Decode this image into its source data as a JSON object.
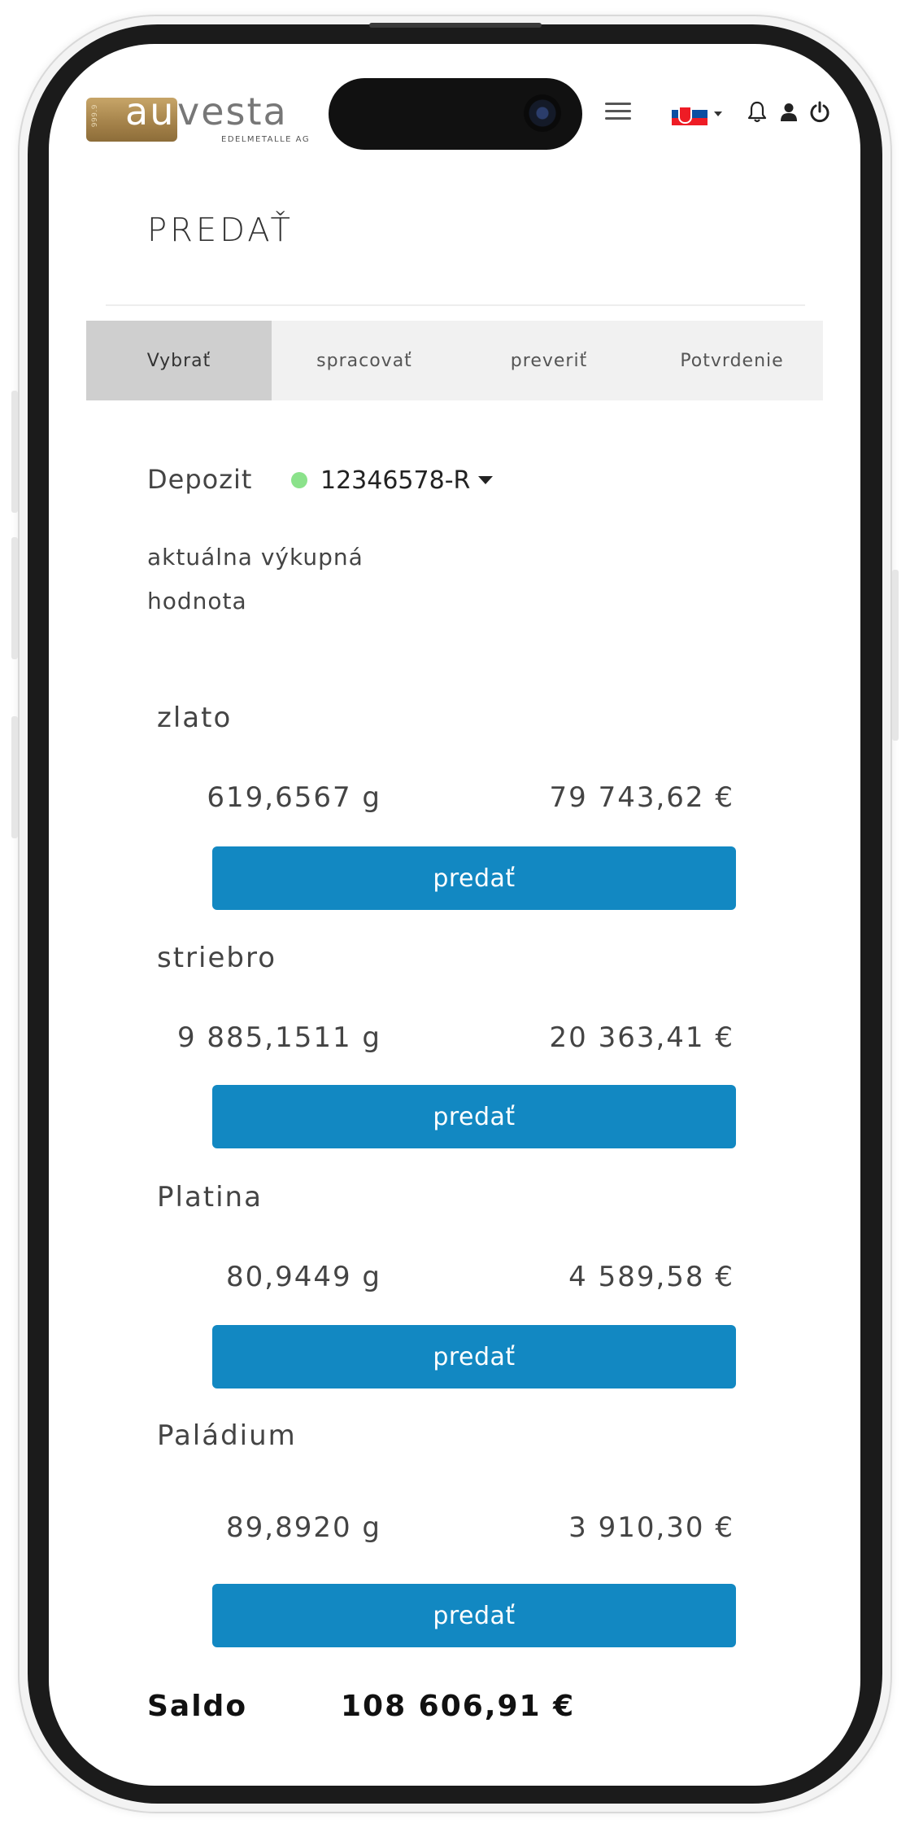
{
  "header": {
    "logo_au": "au",
    "logo_vesta": "vesta",
    "logo_sub": "EDELMETALLE AG",
    "logo_stamp": "999.9",
    "language": "Slovenčina"
  },
  "page": {
    "title": "PREDAŤ"
  },
  "tabs": [
    {
      "label": "Vybrať",
      "active": true
    },
    {
      "label": "spracovať",
      "active": false
    },
    {
      "label": "preveriť",
      "active": false
    },
    {
      "label": "Potvrdenie",
      "active": false
    }
  ],
  "depozit": {
    "label": "Depozit",
    "value": "12346578-R",
    "status_color": "#8be28b"
  },
  "current_value_label": "aktuálna výkupná hodnota",
  "metals": [
    {
      "name": "zlato",
      "weight": "619,6567 g",
      "value": "79 743,62 €",
      "button": "predať"
    },
    {
      "name": "striebro",
      "weight": "9 885,1511 g",
      "value": "20 363,41 €",
      "button": "predať"
    },
    {
      "name": "Platina",
      "weight": "80,9449 g",
      "value": "4 589,58 €",
      "button": "predať"
    },
    {
      "name": "Paládium",
      "weight": "89,8920 g",
      "value": "3 910,30 €",
      "button": "predať"
    }
  ],
  "saldo": {
    "label": "Saldo",
    "value": "108 606,91 €"
  },
  "colors": {
    "accent": "#1288c2",
    "tab_active_bg": "#cfcfcf",
    "tab_bg": "#f1f1f1",
    "logo_gold": "#b08f55"
  },
  "icons": {
    "menu": "hamburger-icon",
    "language": "slovak-flag-icon",
    "notifications": "bell-icon",
    "profile": "user-icon",
    "logout": "power-icon"
  }
}
